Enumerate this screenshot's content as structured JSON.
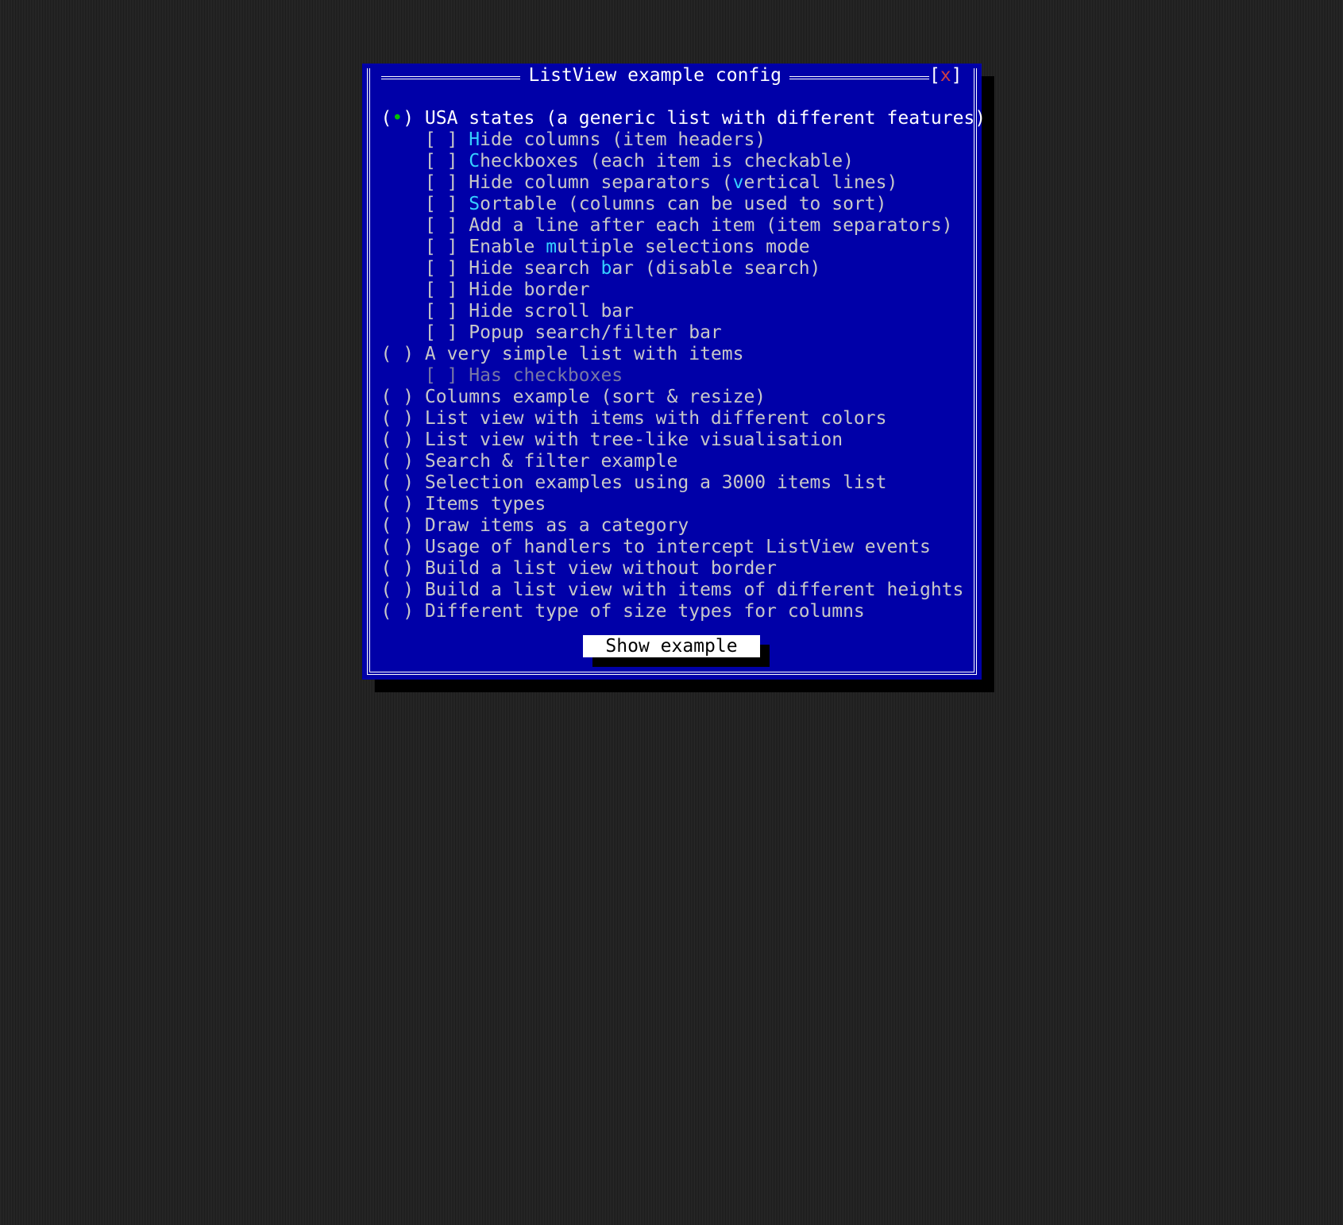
{
  "colors": {
    "dialog_bg": "#0000a8",
    "text": "#c8c8c8",
    "selected_text": "#ffffff",
    "hotkey": "#36d0ff",
    "bullet": "#00c000",
    "close_x": "#d04040",
    "button_bg": "#ffffff",
    "button_text": "#000000",
    "disabled_text": "#7878a4"
  },
  "dialog": {
    "title": "ListView example config",
    "close_left": "[",
    "close_right": "]",
    "close_char": "x",
    "button_label": "Show example"
  },
  "items": [
    {
      "type": "radio",
      "indent": 0,
      "selected": true,
      "segments": [
        "USA states (a generic list with different features)"
      ],
      "hot": []
    },
    {
      "type": "check",
      "indent": 1,
      "checked": false,
      "segments": [
        "H",
        "ide columns (item headers)"
      ],
      "hot": [
        0
      ]
    },
    {
      "type": "check",
      "indent": 1,
      "checked": false,
      "segments": [
        "C",
        "heckboxes (each item is checkable)"
      ],
      "hot": [
        0
      ]
    },
    {
      "type": "check",
      "indent": 1,
      "checked": false,
      "segments": [
        "Hide column separators (",
        "v",
        "ertical lines)"
      ],
      "hot": [
        1
      ]
    },
    {
      "type": "check",
      "indent": 1,
      "checked": false,
      "segments": [
        "S",
        "ortable (columns can be used to sort)"
      ],
      "hot": [
        0
      ]
    },
    {
      "type": "check",
      "indent": 1,
      "checked": false,
      "segments": [
        "Add a line after each item (item separators)"
      ],
      "hot": []
    },
    {
      "type": "check",
      "indent": 1,
      "checked": false,
      "segments": [
        "Enable ",
        "m",
        "ultiple selections mode"
      ],
      "hot": [
        1
      ]
    },
    {
      "type": "check",
      "indent": 1,
      "checked": false,
      "segments": [
        "Hide search ",
        "b",
        "ar (disable search)"
      ],
      "hot": [
        1
      ]
    },
    {
      "type": "check",
      "indent": 1,
      "checked": false,
      "segments": [
        "Hide border"
      ],
      "hot": []
    },
    {
      "type": "check",
      "indent": 1,
      "checked": false,
      "segments": [
        "Hide scroll bar"
      ],
      "hot": []
    },
    {
      "type": "check",
      "indent": 1,
      "checked": false,
      "segments": [
        "Popup search/filter bar"
      ],
      "hot": []
    },
    {
      "type": "radio",
      "indent": 0,
      "selected": false,
      "segments": [
        "A very simple list with items"
      ],
      "hot": []
    },
    {
      "type": "check",
      "indent": 1,
      "checked": false,
      "disabled": true,
      "segments": [
        "Has checkboxes"
      ],
      "hot": []
    },
    {
      "type": "radio",
      "indent": 0,
      "selected": false,
      "segments": [
        "Columns example (sort & resize)"
      ],
      "hot": []
    },
    {
      "type": "radio",
      "indent": 0,
      "selected": false,
      "segments": [
        "List view with items with different colors"
      ],
      "hot": []
    },
    {
      "type": "radio",
      "indent": 0,
      "selected": false,
      "segments": [
        "List view with tree-like visualisation"
      ],
      "hot": []
    },
    {
      "type": "radio",
      "indent": 0,
      "selected": false,
      "segments": [
        "Search & filter example"
      ],
      "hot": []
    },
    {
      "type": "radio",
      "indent": 0,
      "selected": false,
      "segments": [
        "Selection examples using a 3000 items list"
      ],
      "hot": []
    },
    {
      "type": "radio",
      "indent": 0,
      "selected": false,
      "segments": [
        "Items types"
      ],
      "hot": []
    },
    {
      "type": "radio",
      "indent": 0,
      "selected": false,
      "segments": [
        "Draw items as a category"
      ],
      "hot": []
    },
    {
      "type": "radio",
      "indent": 0,
      "selected": false,
      "segments": [
        "Usage of handlers to intercept ListView events"
      ],
      "hot": []
    },
    {
      "type": "radio",
      "indent": 0,
      "selected": false,
      "segments": [
        "Build a list view without border"
      ],
      "hot": []
    },
    {
      "type": "radio",
      "indent": 0,
      "selected": false,
      "segments": [
        "Build a list view with items of different heights"
      ],
      "hot": []
    },
    {
      "type": "radio",
      "indent": 0,
      "selected": false,
      "segments": [
        "Different type of size types for columns"
      ],
      "hot": []
    }
  ]
}
